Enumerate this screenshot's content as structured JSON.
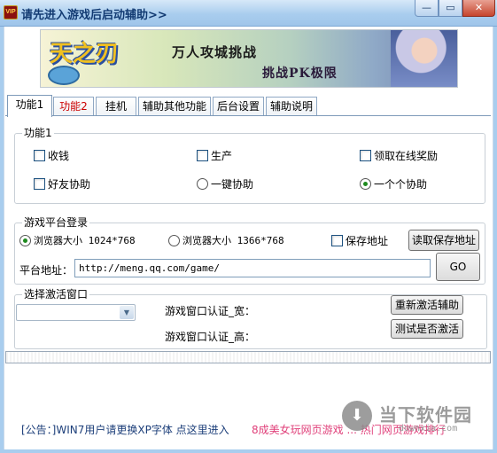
{
  "window": {
    "icon_text": "VIP",
    "title": "请先进入游戏后启动辅助>>",
    "min_glyph": "—",
    "max_glyph": "▭",
    "close_glyph": "✕"
  },
  "banner": {
    "logo": "天之刃",
    "slogan1": "万人攻城挑战",
    "slogan2": "挑战PK极限"
  },
  "tabs": [
    {
      "label": "功能1",
      "active": true
    },
    {
      "label": "功能2"
    },
    {
      "label": "挂机"
    },
    {
      "label": "辅助其他功能"
    },
    {
      "label": "后台设置"
    },
    {
      "label": "辅助说明"
    }
  ],
  "group1": {
    "title": "功能1",
    "options": {
      "collect_money": "收钱",
      "produce": "生产",
      "online_reward": "领取在线奖励",
      "friend_assist": "好友协助",
      "one_key_assist": "一键协助",
      "one_by_one_assist": "一个个协助"
    }
  },
  "group2": {
    "title": "游戏平台登录",
    "radio_1024": "浏览器大小 1024*768",
    "radio_1366": "浏览器大小 1366*768",
    "save_address": "保存地址",
    "read_saved_button": "读取保存地址",
    "platform_label": "平台地址：",
    "platform_value": "http://meng.qq.com/game/",
    "go_button": "GO"
  },
  "group3": {
    "title": "选择激活窗口",
    "combo_value": "",
    "width_label": "游戏窗口认证_宽：",
    "height_label": "游戏窗口认证_高：",
    "reactivate_button": "重新激活辅助",
    "test_button": "测试是否激活"
  },
  "footer": {
    "notice": "[公告：]WIN7用户请更换XP字体 点这里进入",
    "promo": "8成美女玩网页游戏 ... 热门网页游戏排行"
  },
  "watermark": {
    "title": "当下软件园",
    "sub": "downxia.com"
  },
  "colors": {
    "titlebar": "#a9cdee",
    "tab_red": "#cc0000",
    "promo_pink": "#e0407a"
  }
}
